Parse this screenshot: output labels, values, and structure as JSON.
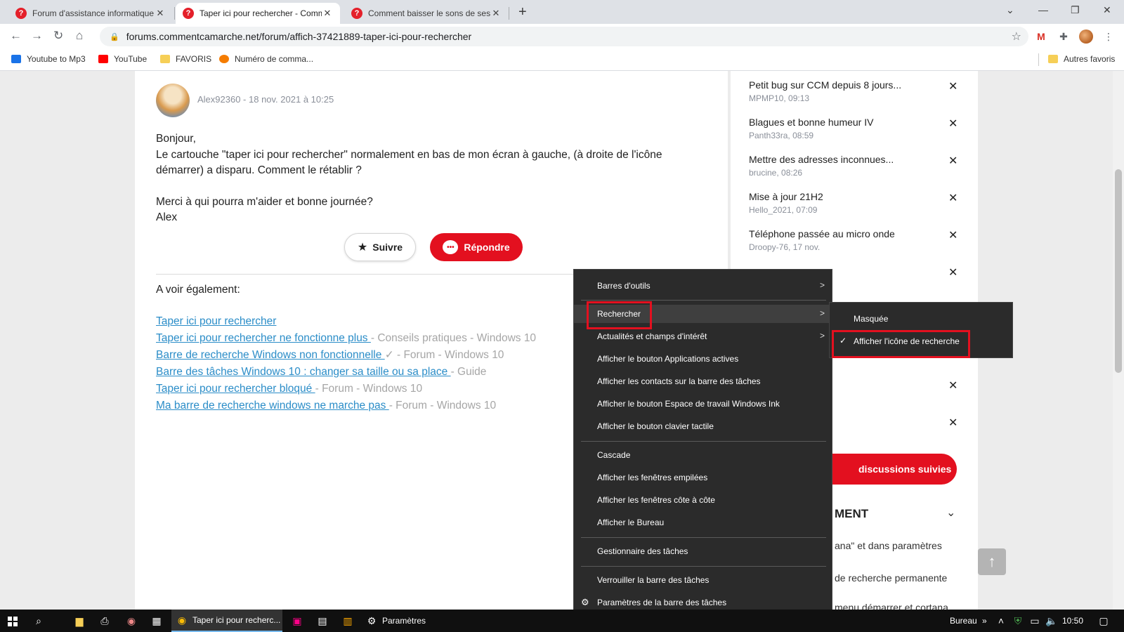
{
  "browser": {
    "tabs": [
      {
        "title": "Forum d'assistance informatique",
        "active": false
      },
      {
        "title": "Taper ici pour rechercher - Comm",
        "active": true
      },
      {
        "title": "Comment baisser le sons de ses",
        "active": false
      }
    ],
    "url": "forums.commentcamarche.net/forum/affich-37421889-taper-ici-pour-rechercher",
    "bookmarks": [
      {
        "label": "Youtube to Mp3",
        "color": "#1a73e8"
      },
      {
        "label": "YouTube",
        "color": "#ff0000"
      },
      {
        "label": "FAVORIS",
        "color": "#f6cf57"
      },
      {
        "label": "Numéro de comma...",
        "color": "#f57c00"
      }
    ],
    "other_bookmarks": "Autres favoris"
  },
  "post": {
    "meta": "Alex92360 - 18 nov. 2021 à 10:25",
    "greeting": "Bonjour,",
    "line1": "Le cartouche \"taper ici pour rechercher\" normalement en bas de mon écran à gauche, (à droite de l'icône",
    "line2": "démarrer) a disparu. Comment le rétablir ?",
    "line3": "Merci à qui pourra m'aider et bonne journée?",
    "signature": "Alex",
    "follow_label": "Suivre",
    "reply_label": "Répondre"
  },
  "see_also": {
    "title": "A voir également:",
    "links": [
      {
        "text": "Taper ici pour rechercher",
        "meta": ""
      },
      {
        "text": "Taper ici pour rechercher ne fonctionne plus ",
        "meta": "- Conseils pratiques - Windows 10"
      },
      {
        "text": "Barre de recherche Windows non fonctionnelle ",
        "meta": "✓ - Forum - Windows 10"
      },
      {
        "text": "Barre des tâches Windows 10 : changer sa taille ou sa place ",
        "meta": "- Guide"
      },
      {
        "text": "Taper ici pour rechercher bloqué ",
        "meta": "- Forum - Windows 10"
      },
      {
        "text": "Ma barre de recherche windows ne marche pas ",
        "meta": "- Forum - Windows 10"
      }
    ]
  },
  "sidebar": {
    "items": [
      {
        "title": "Petit bug sur CCM depuis 8 jours...",
        "author": "MPMP10",
        "time": "09:13"
      },
      {
        "title": "Blagues et bonne humeur IV",
        "author": "Panth33ra",
        "time": "08:59"
      },
      {
        "title": "Mettre des adresses inconnues...",
        "author": "brucine",
        "time": "08:26"
      },
      {
        "title": "Mise à jour 21H2",
        "author": "Hello_2021",
        "time": "07:09"
      },
      {
        "title": "Téléphone passée au micro onde",
        "author": "Droopy-76",
        "time": "17 nov."
      }
    ],
    "cta_label": "discussions suivies",
    "heading_fragment": "MENT",
    "text_fragments": [
      "ana\" et dans paramètres",
      "de recherche permanente",
      "menu démarrer et cortana"
    ]
  },
  "context_menu": {
    "items": [
      {
        "label": "Barres d'outils",
        "arrow": true
      },
      {
        "label": "Rechercher",
        "arrow": true
      },
      {
        "label": "Actualités et champs d'intérêt",
        "arrow": true
      },
      {
        "label": "Afficher le bouton Applications actives"
      },
      {
        "label": "Afficher les contacts sur la barre des tâches"
      },
      {
        "label": "Afficher le bouton Espace de travail Windows Ink"
      },
      {
        "label": "Afficher le bouton clavier tactile"
      },
      {
        "label": "Cascade"
      },
      {
        "label": "Afficher les fenêtres empilées"
      },
      {
        "label": "Afficher les fenêtres côte à côte"
      },
      {
        "label": "Afficher le Bureau"
      },
      {
        "label": "Gestionnaire des tâches"
      },
      {
        "label": "Verrouiller la barre des tâches"
      },
      {
        "label": "Paramètres de la barre des tâches"
      }
    ],
    "submenu": [
      {
        "label": "Masquée",
        "checked": false
      },
      {
        "label": "Afficher l'icône de recherche",
        "checked": true
      }
    ]
  },
  "taskbar": {
    "chrome_app": "Taper ici pour recherc...",
    "settings_app": "Paramètres",
    "desktop_label": "Bureau",
    "time": "10:50"
  },
  "colors": {
    "accent_red": "#e3101f",
    "link_blue": "#2b8dc8",
    "menu_bg": "#2b2b2b"
  }
}
